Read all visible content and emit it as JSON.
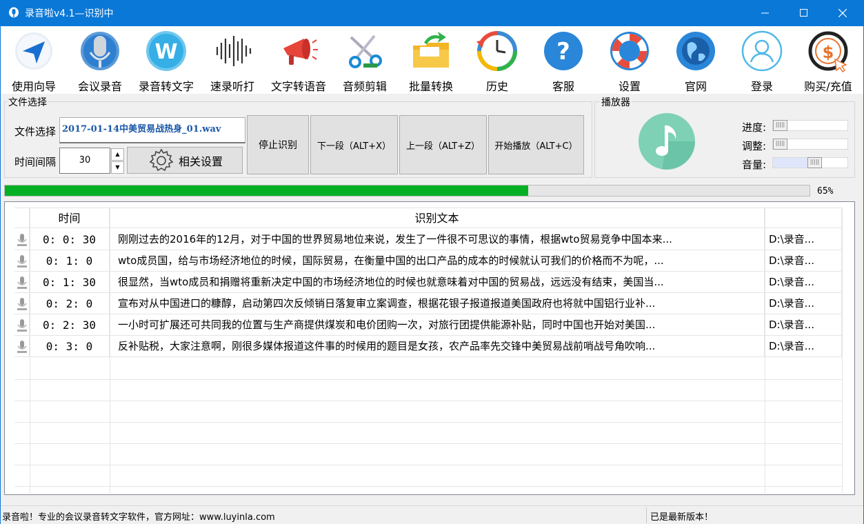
{
  "window": {
    "title": "录音啦v4.1—识别中"
  },
  "toolbar": {
    "items": [
      {
        "label": "使用向导",
        "icon": "navigation-arrow-icon"
      },
      {
        "label": "会议录音",
        "icon": "microphone-icon"
      },
      {
        "label": "录音转文字",
        "icon": "w-letter-icon"
      },
      {
        "label": "速录听打",
        "icon": "sound-wave-icon"
      },
      {
        "label": "文字转语音",
        "icon": "megaphone-icon"
      },
      {
        "label": "音频剪辑",
        "icon": "scissors-icon"
      },
      {
        "label": "批量转换",
        "icon": "folder-arrow-icon"
      },
      {
        "label": "历史",
        "icon": "history-clock-icon"
      },
      {
        "label": "客服",
        "icon": "question-mark-icon"
      },
      {
        "label": "设置",
        "icon": "lifebuoy-icon"
      },
      {
        "label": "官网",
        "icon": "globe-icon"
      },
      {
        "label": "登录",
        "icon": "user-icon"
      },
      {
        "label": "购买/充值",
        "icon": "dollar-coin-icon"
      }
    ]
  },
  "file_panel": {
    "group_title": "文件选择",
    "file_label": "文件选择",
    "file_value": "2017-01-14中美贸易战热身_01.wav",
    "interval_label": "时间间隔",
    "interval_value": "30",
    "settings_button": "相关设置"
  },
  "actions": {
    "stop": "停止识别",
    "next": "下一段（ALT+X）",
    "prev": "上一段（ALT+Z）",
    "play": "开始播放（ALT+C）"
  },
  "player": {
    "group_title": "播放器",
    "progress_label": "进度:",
    "adjust_label": "调整:",
    "volume_label": "音量:",
    "progress_level": 0,
    "adjust_level": 0,
    "volume_level": 0.58
  },
  "recognition": {
    "progress_percent": 65,
    "progress_text": "65%"
  },
  "table": {
    "columns": [
      "时间",
      "识别文本",
      ""
    ],
    "rows": [
      {
        "time": "0: 0: 30",
        "text": "刚刚过去的2016年的12月，对于中国的世界贸易地位来说，发生了一件很不可思议的事情，根据wto贸易竞争中国本来...",
        "path": "D:\\录音..."
      },
      {
        "time": "0: 1: 0",
        "text": "wto成员国，给与市场经济地位的时候，国际贸易，在衡量中国的出口产品的成本的时候就认可我们的价格而不为呢，...",
        "path": "D:\\录音..."
      },
      {
        "time": "0: 1: 30",
        "text": "很显然，当wto成员和捐赠将重新决定中国的市场经济地位的时候也就意味着对中国的贸易战，远远没有结束，美国当...",
        "path": "D:\\录音..."
      },
      {
        "time": "0: 2: 0",
        "text": "宣布对从中国进口的糠醇，启动第四次反倾销日落复审立案调查，根据花银子报道报道美国政府也将就中国铝行业补...",
        "path": "D:\\录音..."
      },
      {
        "time": "0: 2: 30",
        "text": "一小时可扩展还可共同我的位置与生产商提供煤炭和电价团购一次，对旅行团提供能源补贴，同时中国也开始对美国...",
        "path": "D:\\录音..."
      },
      {
        "time": "0: 3: 0",
        "text": "反补贴税，大家注意啊，刚很多媒体报道这件事的时候用的题目是女孩，农产品率先交锋中美贸易战前哨战号角吹响...",
        "path": "D:\\录音..."
      }
    ]
  },
  "status": {
    "left": "录音啦！专业的会议录音转文字软件，官方网址：www.luyinla.com",
    "right": "已是最新版本！"
  },
  "colors": {
    "titlebar": "#0a78d7",
    "progress": "#06b025",
    "player_circle": "#7fd1b6"
  }
}
